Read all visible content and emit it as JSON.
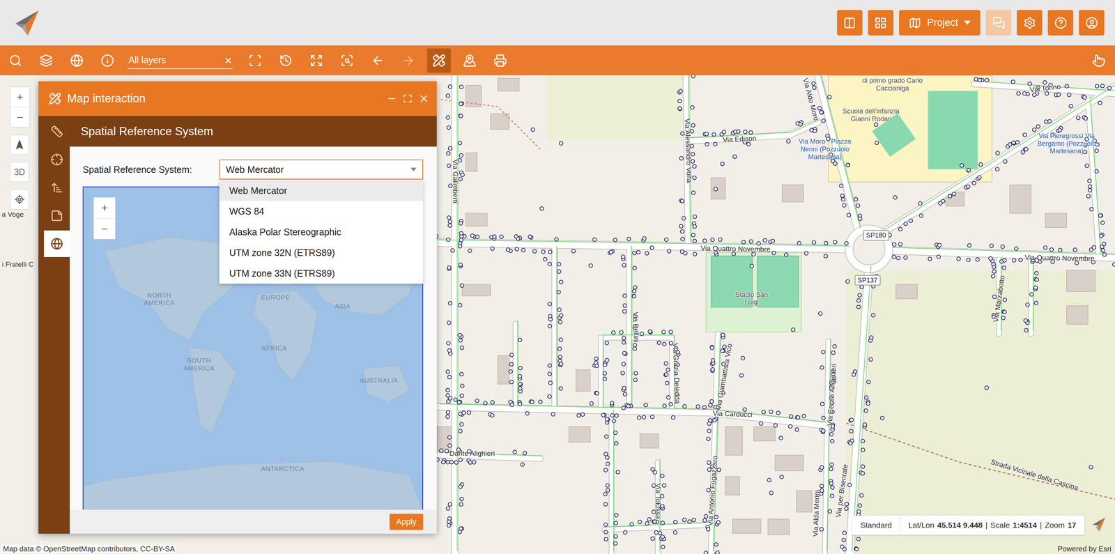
{
  "header": {
    "buttons": [
      {
        "kind": "icon",
        "disabled": false
      },
      {
        "kind": "icon",
        "disabled": false
      },
      {
        "kind": "menu",
        "label": "Project",
        "disabled": false
      },
      {
        "kind": "icon",
        "disabled": true
      },
      {
        "kind": "icon",
        "disabled": false
      },
      {
        "kind": "icon",
        "disabled": false
      },
      {
        "kind": "icon",
        "disabled": false
      }
    ]
  },
  "toolbar": {
    "tools_left": [
      {
        "active": false,
        "disabled": false
      },
      {
        "active": false,
        "disabled": false
      },
      {
        "active": false,
        "disabled": false
      },
      {
        "active": false,
        "disabled": false
      }
    ],
    "layer_filter": {
      "value": "All layers",
      "clear": "×"
    },
    "tools_right": [
      {
        "active": false,
        "disabled": false
      },
      {
        "active": false,
        "disabled": false
      },
      {
        "active": false,
        "disabled": false
      },
      {
        "active": false,
        "disabled": false
      },
      {
        "active": false,
        "disabled": false
      },
      {
        "active": false,
        "disabled": true
      },
      {
        "active": true,
        "disabled": false
      },
      {
        "active": false,
        "disabled": false
      },
      {
        "active": false,
        "disabled": false
      }
    ],
    "end_tool": {
      "active": false,
      "disabled": false
    }
  },
  "map_controls": {
    "zoom_in": "+",
    "zoom_out": "−",
    "view_3d": "3D"
  },
  "panel": {
    "title": "Map interaction",
    "sidebar": [
      {
        "selected": false
      },
      {
        "selected": false
      },
      {
        "selected": false
      },
      {
        "selected": false
      },
      {
        "selected": true
      }
    ],
    "section_title": "Spatial Reference System",
    "field_label": "Spatial Reference System:",
    "select": {
      "value": "Web Mercator",
      "open": true,
      "options": [
        {
          "label": "Web Mercator",
          "selected": true
        },
        {
          "label": "WGS 84",
          "selected": false
        },
        {
          "label": "Alaska Polar Stereographic",
          "selected": false
        },
        {
          "label": "UTM zone 32N (ETRS89)",
          "selected": false
        },
        {
          "label": "UTM zone 33N (ETRS89)",
          "selected": false
        }
      ]
    },
    "minimap": {
      "zoom_in": "+",
      "zoom_out": "−",
      "labels": [
        "NORTH AMERICA",
        "EUROPE",
        "ASIA",
        "AFRICA",
        "SOUTH AMERICA",
        "AUSTRALIA",
        "ANTARCTICA"
      ]
    },
    "apply": "Apply"
  },
  "map": {
    "labels": [
      {
        "text": "Via Quattro Novembre",
        "kind": "street"
      },
      {
        "text": "Via Quattro Novembre",
        "kind": "street"
      },
      {
        "text": "Via Edison",
        "kind": "street"
      },
      {
        "text": "Via Alessandro Volta",
        "kind": "street"
      },
      {
        "text": "Via Aldo Moro",
        "kind": "street"
      },
      {
        "text": "Via Galimberti",
        "kind": "street"
      },
      {
        "text": "Via Bellini",
        "kind": "street"
      },
      {
        "text": "Via Grazia Deledda",
        "kind": "street"
      },
      {
        "text": "Via Giambattista Vico",
        "kind": "street"
      },
      {
        "text": "Via Carducci",
        "kind": "street"
      },
      {
        "text": "Via Cecco Angiolieri",
        "kind": "street"
      },
      {
        "text": "Via per Bisenrate",
        "kind": "street"
      },
      {
        "text": "Via Alda Merini",
        "kind": "street"
      },
      {
        "text": "Via Marzabotto",
        "kind": "street"
      },
      {
        "text": "Dante Alighieri",
        "kind": "street"
      },
      {
        "text": "Via Tolussa",
        "kind": "street"
      },
      {
        "text": "Via Antonio Fogazzaro",
        "kind": "street"
      },
      {
        "text": "Strada Vicinale della Cascina",
        "kind": "street"
      },
      {
        "text": "Via Torino",
        "kind": "street"
      },
      {
        "text": "a Voge",
        "kind": "street"
      },
      {
        "text": "i Fratelli C",
        "kind": "street"
      },
      {
        "text": "Stadio San Luigi",
        "kind": "place"
      },
      {
        "text": "Scuola dell'infanzia Gianni Rodari",
        "kind": "place"
      },
      {
        "text": "di primo grado Carlo Caccianiga",
        "kind": "place"
      },
      {
        "text": "Via Moro - Piazza Nenni (Pozzuolo Martesana)",
        "kind": "transit"
      },
      {
        "text": "Via Pieregrossi Via Bergamo (Pozzuolo Martesana)",
        "kind": "transit"
      },
      {
        "text": "SP180",
        "kind": "ref"
      },
      {
        "text": "SP137",
        "kind": "ref"
      }
    ]
  },
  "status_bar": {
    "basemap": "Standard",
    "lat_lon_label": "Lat/Lon",
    "lat_lon": "45.514 9.448",
    "separator": "|",
    "scale_label": "Scale",
    "scale": "1:4514",
    "zoom_label": "Zoom",
    "zoom": "17"
  },
  "attribution": "Map data © OpenStreetMap contributors, CC-BY-SA",
  "powered_by": "Powered by Esri"
}
